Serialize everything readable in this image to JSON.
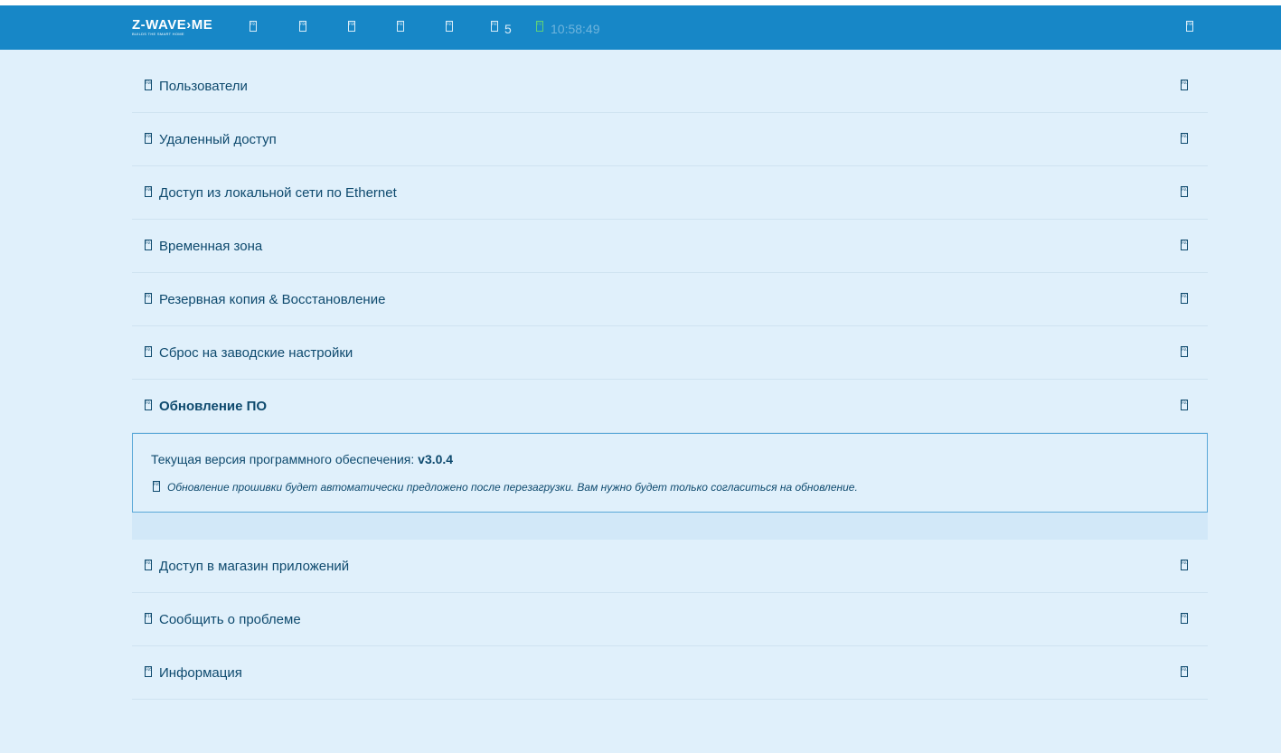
{
  "navbar": {
    "logo": "Z-WAVE›ME",
    "logo_sub": "BUILDS THE SMART HOME",
    "icons": [
      {
        "name": "home-icon",
        "glyph": "F015"
      },
      {
        "name": "elements-icon",
        "glyph": "F0F1"
      },
      {
        "name": "rooms-icon",
        "glyph": "F0F0"
      },
      {
        "name": "events-icon",
        "glyph": "F013"
      },
      {
        "name": "settings-icon",
        "glyph": "F013"
      }
    ],
    "notification_icon": "F015",
    "notification_count": "5",
    "clock_icon": "F017",
    "time": "10:58:49",
    "menu_icon": "F0C9"
  },
  "menu": {
    "items": [
      {
        "label": "Пользователи",
        "icon": "F0C0",
        "chevron": "F078"
      },
      {
        "label": "Удаленный доступ",
        "icon": "F0AC",
        "chevron": "F078"
      },
      {
        "label": "Доступ из локальной сети по Ethernet",
        "icon": "F0E8",
        "chevron": "F078"
      },
      {
        "label": "Временная зона",
        "icon": "F017",
        "chevron": "F078"
      },
      {
        "label": "Резервная копия & Восстановление",
        "icon": "F019",
        "chevron": "F078"
      },
      {
        "label": "Сброс на заводские настройки",
        "icon": "F01E",
        "chevron": "F078"
      }
    ],
    "active": {
      "label": "Обновление ПО",
      "icon": "F01E",
      "chevron": "F077",
      "version_label": "Текущая версия программного обеспечения:",
      "version_value": "v3.0.4",
      "note_icon": "F05A",
      "note": "Обновление прошивки будет автоматически предложено после перезагрузки. Вам нужно будет только согласиться на обновление."
    },
    "items_after": [
      {
        "label": "Доступ в магазин приложений",
        "icon": "F07A",
        "chevron": "F078"
      },
      {
        "label": "Сообщить о проблеме",
        "icon": "F188",
        "chevron": "F078"
      },
      {
        "label": "Информация",
        "icon": "F05A",
        "chevron": "F078"
      }
    ]
  },
  "colors": {
    "navbar": "#1787c7",
    "background": "#e0f0fb",
    "text": "#0e4a6e",
    "panel_border": "#5aa8d8",
    "clock": "#5fd07a"
  }
}
